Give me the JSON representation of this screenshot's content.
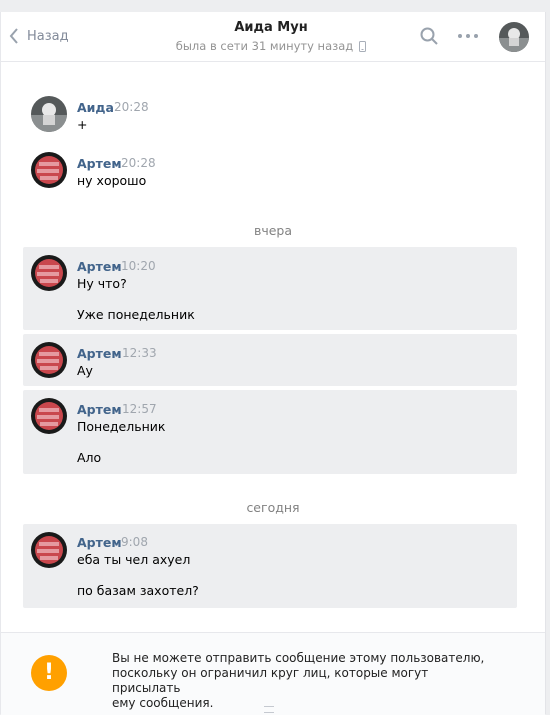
{
  "header": {
    "back_label": "Назад",
    "title": "Аида Мун",
    "status": "была в сети 31 минуту назад"
  },
  "messages_top": [
    {
      "author": "Аида",
      "time": "20:28",
      "lines": [
        "+"
      ]
    },
    {
      "author": "Артем",
      "time": "20:28",
      "lines": [
        "ну хорошо"
      ]
    }
  ],
  "date_separators": {
    "yesterday": "вчера",
    "today": "сегодня"
  },
  "messages_yesterday": [
    {
      "author": "Артем",
      "time": "10:20",
      "lines": [
        "Ну что?",
        "Уже понедельник"
      ]
    },
    {
      "author": "Артем",
      "time": "12:33",
      "lines": [
        "Ау"
      ]
    },
    {
      "author": "Артем",
      "time": "12:57",
      "lines": [
        "Понедельник",
        "Ало"
      ]
    }
  ],
  "messages_today": [
    {
      "author": "Артем",
      "time": "9:08",
      "lines": [
        "еба ты чел ахуел",
        "по базам захотел?"
      ]
    }
  ],
  "footer": {
    "notice_line1": "Вы не можете отправить сообщение этому пользователю,",
    "notice_line2": "поскольку он ограничил круг лиц, которые могут присылать",
    "notice_line3": "ему сообщения.",
    "icon": "exclamation-icon",
    "icon_color": "#ffa000"
  },
  "colors": {
    "author": "#42648b",
    "selected_bg": "#edeef0"
  }
}
